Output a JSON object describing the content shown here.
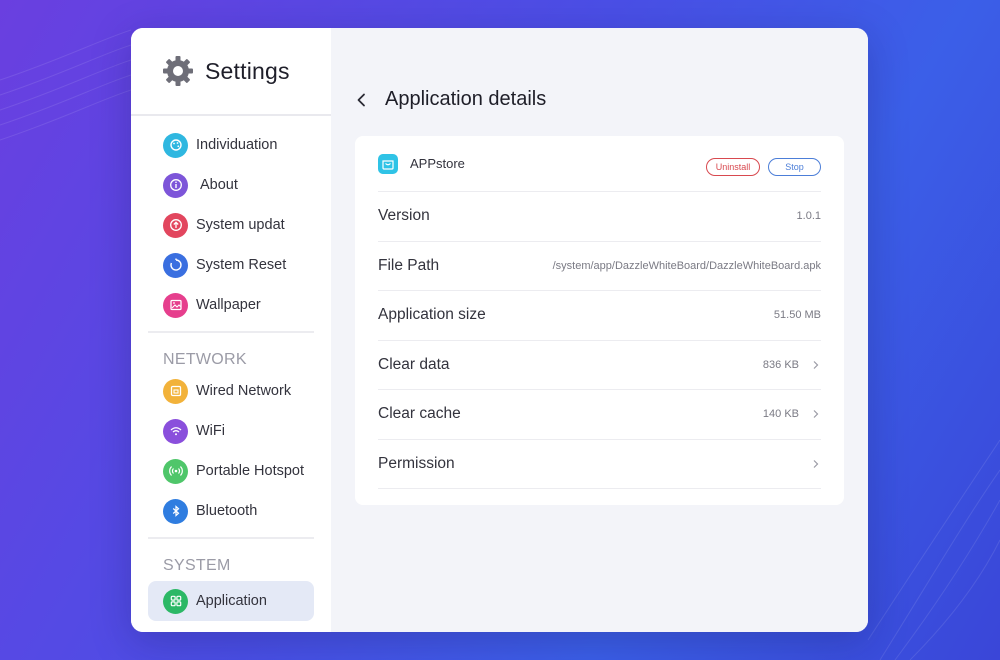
{
  "sidebar": {
    "title": "Settings",
    "items": [
      {
        "label": "Individuation",
        "icon": "palette-icon",
        "color": "#2fb7e0"
      },
      {
        "label": "About",
        "icon": "info-icon",
        "color": "#7d55d9"
      },
      {
        "label": "System updat",
        "icon": "upgrade-icon",
        "color": "#e2465e"
      },
      {
        "label": "System Reset",
        "icon": "reset-icon",
        "color": "#3a6fe0"
      },
      {
        "label": "Wallpaper",
        "icon": "image-icon",
        "color": "#e63f8d"
      }
    ],
    "network_label": "NETWORK",
    "network_items": [
      {
        "label": "Wired Network",
        "icon": "ethernet-icon",
        "color": "#f2b23a"
      },
      {
        "label": "WiFi",
        "icon": "wifi-icon",
        "color": "#8a4fdc"
      },
      {
        "label": "Portable Hotspot",
        "icon": "hotspot-icon",
        "color": "#4fc66a"
      },
      {
        "label": "Bluetooth",
        "icon": "bluetooth-icon",
        "color": "#2f7de0"
      }
    ],
    "system_label": "SYSTEM",
    "system_items": [
      {
        "label": "Application",
        "icon": "apps-icon",
        "color": "#2cb866"
      }
    ]
  },
  "main": {
    "title": "Application details",
    "app": {
      "name": "APPstore",
      "uninstall_label": "Uninstall",
      "stop_label": "Stop"
    },
    "rows": [
      {
        "key": "Version",
        "value": "1.0.1"
      },
      {
        "key": "File Path",
        "value": "/system/app/DazzleWhiteBoard/DazzleWhiteBoard.apk"
      },
      {
        "key": "Application size",
        "value": "51.50 MB"
      },
      {
        "key": "Clear data",
        "value": "836 KB"
      },
      {
        "key": "Clear cache",
        "value": "140 KB"
      },
      {
        "key": "Permission",
        "value": ""
      }
    ]
  }
}
